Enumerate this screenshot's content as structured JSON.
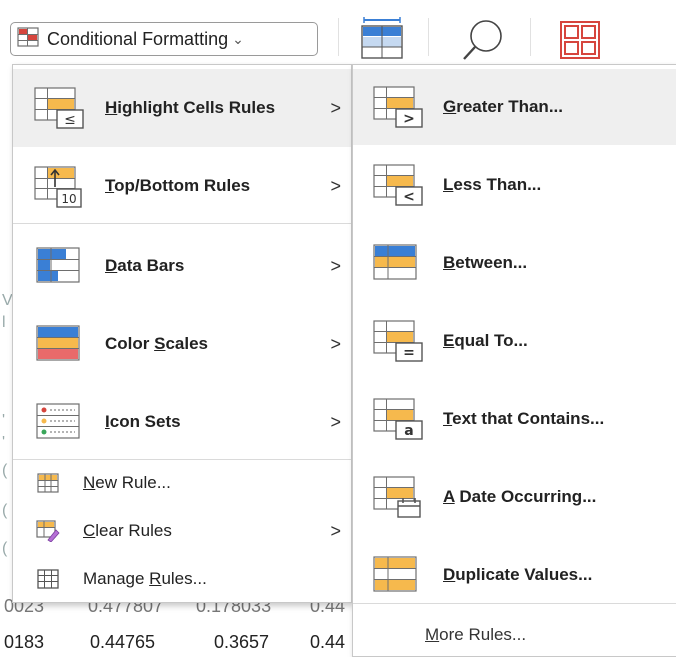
{
  "ribbon": {
    "conditional_formatting": {
      "label": "Conditional Formatting",
      "chevron": "⌄",
      "icon": "conditional-formatting-icon"
    },
    "icons": [
      "format-as-table-icon",
      "find-icon",
      "cell-styles-icon"
    ]
  },
  "sheet": {
    "row_partial": {
      "c1": "0023",
      "c2": "0.477807",
      "c3": "0.178033",
      "c4": "0.44"
    },
    "row_last": {
      "c1": "0183",
      "c2": "0.44765",
      "c3": "0.3657",
      "c4": "0.44"
    },
    "faint_chars": [
      "V",
      "l",
      "'",
      "'",
      "(",
      "(",
      "("
    ]
  },
  "main_menu": {
    "items": [
      {
        "pre": "",
        "ul": "H",
        "post": "ighlight Cells Rules",
        "icon": "highlight-cells-rules-icon",
        "has_submenu": true,
        "highlighted": true
      },
      {
        "pre": "",
        "ul": "T",
        "post": "op/Bottom Rules",
        "icon": "top-bottom-rules-icon",
        "has_submenu": true
      },
      {
        "pre": "",
        "ul": "D",
        "post": "ata Bars",
        "icon": "data-bars-icon",
        "has_submenu": true
      },
      {
        "pre": "Color ",
        "ul": "S",
        "post": "cales",
        "icon": "color-scales-icon",
        "has_submenu": true
      },
      {
        "pre": "",
        "ul": "I",
        "post": "con Sets",
        "icon": "icon-sets-icon",
        "has_submenu": true
      }
    ],
    "small_items": [
      {
        "pre": "",
        "ul": "N",
        "post": "ew Rule...",
        "icon": "new-rule-icon",
        "has_submenu": false
      },
      {
        "pre": "",
        "ul": "C",
        "post": "lear Rules",
        "icon": "clear-rules-icon",
        "has_submenu": true
      },
      {
        "pre": "Manage ",
        "ul": "R",
        "post": "ules...",
        "icon": "manage-rules-icon",
        "has_submenu": false
      }
    ],
    "arrow": ">"
  },
  "sub_menu": {
    "items": [
      {
        "pre": "",
        "ul": "G",
        "post": "reater Than...",
        "icon": "greater-than-icon",
        "highlighted": true
      },
      {
        "pre": "",
        "ul": "L",
        "post": "ess Than...",
        "icon": "less-than-icon"
      },
      {
        "pre": "",
        "ul": "B",
        "post": "etween...",
        "icon": "between-icon"
      },
      {
        "pre": "",
        "ul": "E",
        "post": "qual To...",
        "icon": "equal-to-icon"
      },
      {
        "pre": "",
        "ul": "T",
        "post": "ext that Contains...",
        "icon": "text-contains-icon"
      },
      {
        "pre": "",
        "ul": "A",
        "post": " Date Occurring...",
        "icon": "date-occurring-icon"
      },
      {
        "pre": "",
        "ul": "D",
        "post": "uplicate Values...",
        "icon": "duplicate-values-icon"
      }
    ],
    "more": {
      "pre": "",
      "ul": "M",
      "post": "ore Rules..."
    }
  },
  "colors": {
    "accent_orange": "#f6b94d",
    "accent_red": "#d6453d",
    "accent_blue": "#3a7fd5",
    "highlight": "#efefef",
    "grid_stroke": "#6e6e6e"
  }
}
